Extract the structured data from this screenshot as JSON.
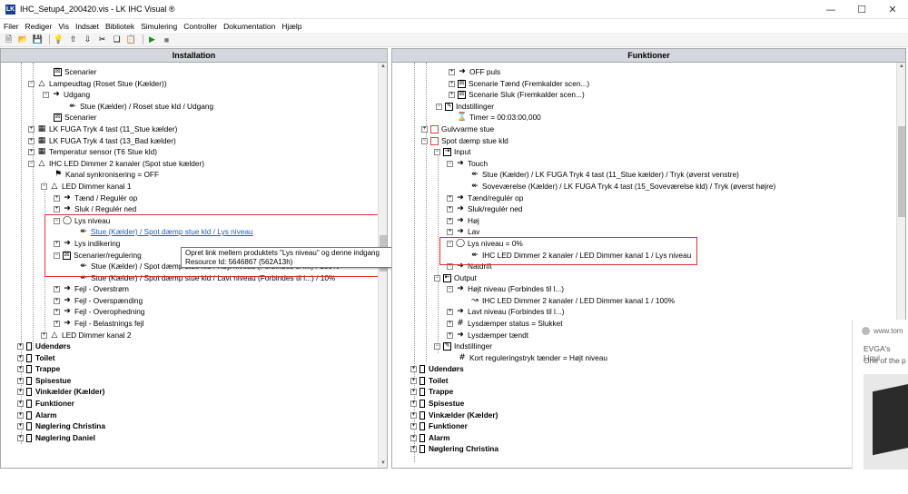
{
  "window": {
    "title": "IHC_Setup4_200420.vis - LK IHC Visual ®",
    "logo": "LK"
  },
  "menu": [
    "Filer",
    "Rediger",
    "Vis",
    "Indsæt",
    "Bibliotek",
    "Simulering",
    "Controller",
    "Dokumentation",
    "Hjælp"
  ],
  "left": {
    "header": "Installation",
    "rows": [
      "Scenarier",
      "Lampeudtag (Roset Stue (Kælder))",
      "Udgang",
      "Stue (Kælder) / Roset stue kld / Udgang",
      "Scenarier",
      "LK FUGA Tryk 4 tast (11_Stue kælder)",
      "LK FUGA Tryk 4 tast (13_Bad kælder)",
      "Temperatur sensor (T6 Stue kld)",
      "IHC LED Dimmer 2 kanaler (Spot stue kælder)",
      "Kanal synkronisering = OFF",
      "LED Dimmer kanal 1",
      "Tænd / Regulér op",
      "Sluk / Regulér ned",
      "Lys niveau",
      "Stue (Kælder) / Spot dæmp stue kld / Lys niveau",
      "Lys indikering",
      "Scenarier/regulering",
      "Stue (Kælder) / Spot dæmp stue kld / Højt niveau (Forbindes til l...) / 100%",
      "Stue (Kælder) / Spot dæmp stue kld / Lavt niveau (Forbindes til l...) / 10%",
      "Fejl - Overstrøm",
      "Fejl - Overspænding",
      "Fejl - Overophedning",
      "Fejl - Belastnings fejl",
      "LED Dimmer kanal 2",
      "Udendørs",
      "Toilet",
      "Trappe",
      "Spisestue",
      "Vinkælder (Kælder)",
      "Funktioner",
      "Alarm",
      "Nøglering Christina",
      "Nøglering Daniel"
    ]
  },
  "tooltip": {
    "line1": "Opret link mellem produktets \"Lys niveau\" og denne indgang",
    "line2": "Resource Id: 5646867 (562A13h)"
  },
  "right": {
    "header": "Funktioner",
    "rows": [
      "OFF puls",
      "Scenarie Tænd (Fremkalder scen...)",
      "Scenarie Sluk (Fremkalder scen...)",
      "Indstillinger",
      "Timer = 00:03:00,000",
      "Gulvvarme stue",
      "Spot dæmp stue kld",
      "Input",
      "Touch",
      "Stue (Kælder) / LK FUGA Tryk 4 tast (11_Stue kælder)  / Tryk (øverst venstre)",
      "Soveværelse (Kælder) / LK FUGA Tryk 4 tast (15_Soveværelse kld)  / Tryk (øverst højre)",
      "Tænd/regulér op",
      "Sluk/regulér ned",
      "Høj",
      "Lav",
      "Lys niveau  = 0%",
      "IHC LED Dimmer 2 kanaler / LED Dimmer kanal 1 / Lys niveau",
      "Natdrift",
      "Output",
      "Højt niveau (Forbindes til l...)",
      "IHC LED Dimmer 2 kanaler / LED Dimmer kanal 1 / 100%",
      "Lavt niveau (Forbindes til l...)",
      "Lysdæmper status = Slukket",
      "Lysdæmper tændt",
      "Indstillinger",
      "Kort reguleringstryk tænder = Højt niveau",
      "Udendørs",
      "Toilet",
      "Trappe",
      "Spisestue",
      "Vinkælder (Kælder)",
      "Funktioner",
      "Alarm",
      "Nøglering Christina"
    ]
  },
  "overlay": {
    "url": "www.tom",
    "line1": "EVGA's Liqui",
    "line2": "One of the p"
  }
}
